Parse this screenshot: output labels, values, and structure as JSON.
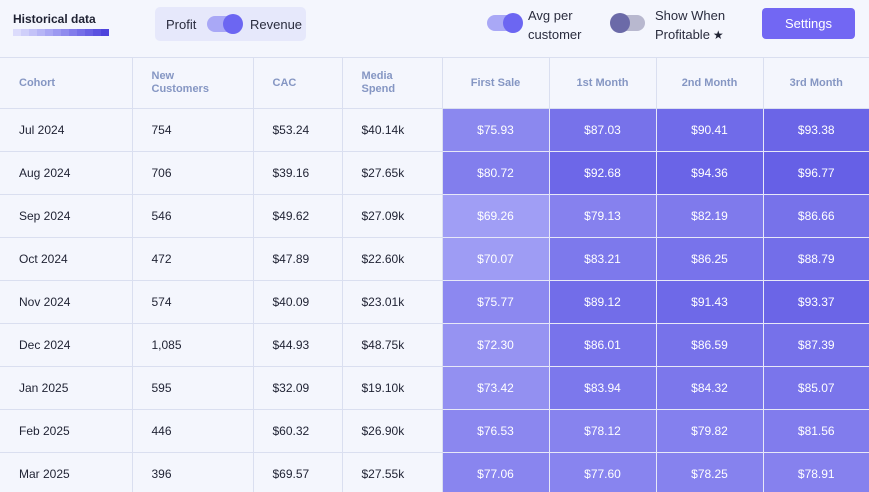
{
  "header": {
    "title": "Historical data",
    "strip_colors": [
      "#dcdcfc",
      "#cfcffa",
      "#c3c2f8",
      "#b6b5f6",
      "#a9a7f4",
      "#9c99f1",
      "#8f8bee",
      "#827ceb",
      "#756ee8",
      "#6860e4",
      "#5b52e0",
      "#4e44dc"
    ],
    "toggle": {
      "left_label": "Profit",
      "right_label": "Revenue",
      "state": "Revenue"
    },
    "avg_per_customer": {
      "label": "Avg per customer",
      "on": true
    },
    "show_when_profitable": {
      "label": "Show When Profitable",
      "star": "★",
      "on": false
    },
    "settings_label": "Settings"
  },
  "table": {
    "columns": [
      "Cohort",
      "New Customers",
      "CAC",
      "Media Spend",
      "First Sale",
      "1st Month",
      "2nd Month",
      "3rd Month"
    ],
    "heat_colors": {
      "lightest": "#b9b8fb",
      "darkest": "#6660e6"
    },
    "rows": [
      {
        "cohort": "Jul 2024",
        "new_customers": "754",
        "cac": "$53.24",
        "media_spend": "$40.14k",
        "values": [
          "$75.93",
          "$87.03",
          "$90.41",
          "$93.38"
        ],
        "heat": [
          0.55,
          0.8,
          0.88,
          0.94
        ]
      },
      {
        "cohort": "Aug 2024",
        "new_customers": "706",
        "cac": "$39.16",
        "media_spend": "$27.65k",
        "values": [
          "$80.72",
          "$92.68",
          "$94.36",
          "$96.77"
        ],
        "heat": [
          0.66,
          0.92,
          0.95,
          1.0
        ]
      },
      {
        "cohort": "Sep 2024",
        "new_customers": "546",
        "cac": "$49.62",
        "media_spend": "$27.09k",
        "values": [
          "$69.26",
          "$79.13",
          "$82.19",
          "$86.66"
        ],
        "heat": [
          0.3,
          0.62,
          0.7,
          0.79
        ]
      },
      {
        "cohort": "Oct 2024",
        "new_customers": "472",
        "cac": "$47.89",
        "media_spend": "$22.60k",
        "values": [
          "$70.07",
          "$83.21",
          "$86.25",
          "$88.79"
        ],
        "heat": [
          0.32,
          0.72,
          0.78,
          0.84
        ]
      },
      {
        "cohort": "Nov 2024",
        "new_customers": "574",
        "cac": "$40.09",
        "media_spend": "$23.01k",
        "values": [
          "$75.77",
          "$89.12",
          "$91.43",
          "$93.37"
        ],
        "heat": [
          0.54,
          0.85,
          0.9,
          0.94
        ]
      },
      {
        "cohort": "Dec 2024",
        "new_customers": "1,085",
        "cac": "$44.93",
        "media_spend": "$48.75k",
        "values": [
          "$72.30",
          "$86.01",
          "$86.59",
          "$87.39"
        ],
        "heat": [
          0.42,
          0.78,
          0.79,
          0.81
        ]
      },
      {
        "cohort": "Jan 2025",
        "new_customers": "595",
        "cac": "$32.09",
        "media_spend": "$19.10k",
        "values": [
          "$73.42",
          "$83.94",
          "$84.32",
          "$85.07"
        ],
        "heat": [
          0.46,
          0.73,
          0.74,
          0.76
        ]
      },
      {
        "cohort": "Feb 2025",
        "new_customers": "446",
        "cac": "$60.32",
        "media_spend": "$26.90k",
        "values": [
          "$76.53",
          "$78.12",
          "$79.82",
          "$81.56"
        ],
        "heat": [
          0.56,
          0.6,
          0.64,
          0.68
        ]
      },
      {
        "cohort": "Mar 2025",
        "new_customers": "396",
        "cac": "$69.57",
        "media_spend": "$27.55k",
        "values": [
          "$77.06",
          "$77.60",
          "$78.25",
          "$78.91"
        ],
        "heat": [
          0.58,
          0.59,
          0.61,
          0.62
        ]
      }
    ]
  }
}
